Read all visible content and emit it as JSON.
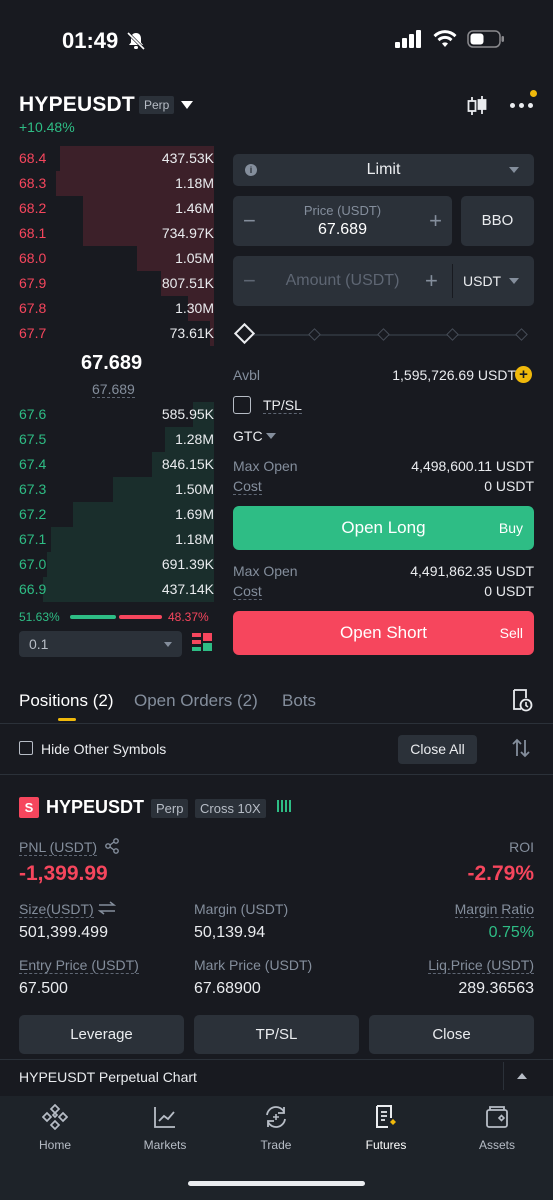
{
  "status": {
    "time": "01:49"
  },
  "header": {
    "pair": "HYPEUSDT",
    "badge": "Perp",
    "change": "+10.48%"
  },
  "orderbook": {
    "asks": [
      {
        "price": "68.4",
        "qty": "437.53K",
        "depth": 0.72
      },
      {
        "price": "68.3",
        "qty": "1.18M",
        "depth": 0.74
      },
      {
        "price": "68.2",
        "qty": "1.46M",
        "depth": 0.61
      },
      {
        "price": "68.1",
        "qty": "734.97K",
        "depth": 0.61
      },
      {
        "price": "68.0",
        "qty": "1.05M",
        "depth": 0.36
      },
      {
        "price": "67.9",
        "qty": "807.51K",
        "depth": 0.25
      },
      {
        "price": "67.8",
        "qty": "1.30M",
        "depth": 0.12
      },
      {
        "price": "67.7",
        "qty": "73.61K",
        "depth": 0.02
      }
    ],
    "mid_price": "67.689",
    "mark_price": "67.689",
    "bids": [
      {
        "price": "67.6",
        "qty": "585.95K",
        "depth": 0.1
      },
      {
        "price": "67.5",
        "qty": "1.28M",
        "depth": 0.23
      },
      {
        "price": "67.4",
        "qty": "846.15K",
        "depth": 0.29
      },
      {
        "price": "67.3",
        "qty": "1.50M",
        "depth": 0.47
      },
      {
        "price": "67.2",
        "qty": "1.69M",
        "depth": 0.66
      },
      {
        "price": "67.1",
        "qty": "1.18M",
        "depth": 0.76
      },
      {
        "price": "67.0",
        "qty": "691.39K",
        "depth": 0.78
      },
      {
        "price": "66.9",
        "qty": "437.14K",
        "depth": 0.8
      }
    ],
    "buy_ratio": "51.63%",
    "sell_ratio": "48.37%",
    "step": "0.1"
  },
  "order_form": {
    "order_type": "Limit",
    "price_label": "Price (USDT)",
    "price_value": "67.689",
    "bbo": "BBO",
    "amount_placeholder": "Amount (USDT)",
    "amount_unit": "USDT",
    "avbl_label": "Avbl",
    "avbl_value": "1,595,726.69 USDT",
    "tpsl_label": "TP/SL",
    "tif": "GTC",
    "long": {
      "max_open_label": "Max Open",
      "max_open_value": "4,498,600.11 USDT",
      "cost_label": "Cost",
      "cost_value": "0 USDT",
      "button": "Open Long",
      "side": "Buy"
    },
    "short": {
      "max_open_label": "Max Open",
      "max_open_value": "4,491,862.35 USDT",
      "cost_label": "Cost",
      "cost_value": "0 USDT",
      "button": "Open Short",
      "side": "Sell"
    }
  },
  "tabs": {
    "positions": "Positions (2)",
    "open_orders": "Open Orders (2)",
    "bots": "Bots"
  },
  "filters": {
    "hide_other": "Hide Other Symbols",
    "close_all": "Close All"
  },
  "position": {
    "side_badge": "S",
    "symbol": "HYPEUSDT",
    "type": "Perp",
    "margin_mode": "Cross 10X",
    "pnl_label": "PNL (USDT)",
    "pnl_value": "-1,399.99",
    "roi_label": "ROI",
    "roi_value": "-2.79%",
    "size_label": "Size(USDT)",
    "size_value": "501,399.499",
    "margin_label": "Margin (USDT)",
    "margin_value": "50,139.94",
    "margin_ratio_label": "Margin Ratio",
    "margin_ratio_value": "0.75%",
    "entry_label": "Entry Price (USDT)",
    "entry_value": "67.500",
    "mark_label": "Mark Price (USDT)",
    "mark_value": "67.68900",
    "liq_label": "Liq.Price (USDT)",
    "liq_value": "289.36563",
    "buttons": {
      "leverage": "Leverage",
      "tpsl": "TP/SL",
      "close": "Close"
    }
  },
  "chart_bar": {
    "label": "HYPEUSDT Perpetual Chart"
  },
  "nav": {
    "home": "Home",
    "markets": "Markets",
    "trade": "Trade",
    "futures": "Futures",
    "assets": "Assets"
  },
  "colors": {
    "up": "#2ebd85",
    "down": "#f6465d",
    "accent": "#f0b90b",
    "bg": "#181a20"
  }
}
